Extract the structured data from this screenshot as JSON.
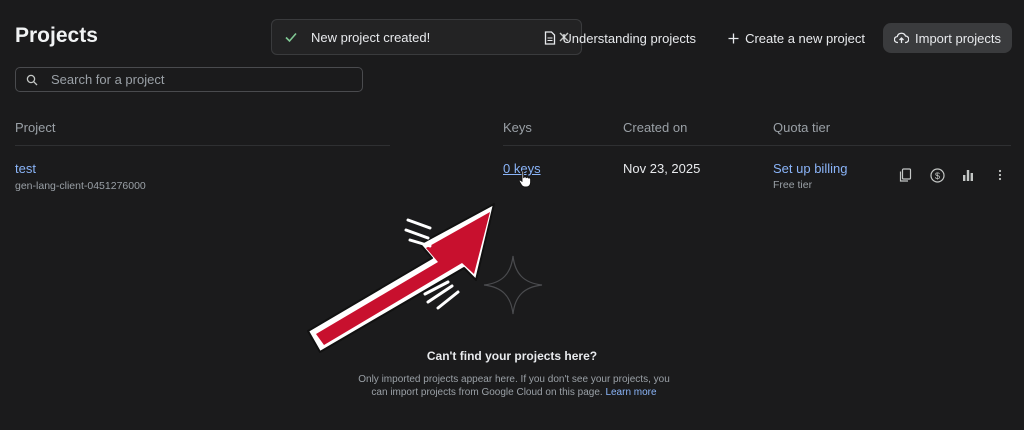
{
  "page": {
    "title": "Projects"
  },
  "toast": {
    "message": "New project created!"
  },
  "actions": {
    "understanding": "Understanding projects",
    "create": "Create a new project",
    "import": "Import projects"
  },
  "search": {
    "placeholder": "Search for a project"
  },
  "table": {
    "columns": [
      "Project",
      "Keys",
      "Created on",
      "Quota tier"
    ],
    "rows": [
      {
        "name": "test",
        "id": "gen-lang-client-0451276000",
        "keys": "0 keys",
        "created": "Nov 23, 2025",
        "billing": "Set up billing",
        "tier": "Free tier"
      }
    ]
  },
  "empty": {
    "title": "Can't find your projects here?",
    "desc_part1": "Only imported projects appear here. If you don't see your projects, you can import projects from Google Cloud on this page.",
    "link": "Learn more"
  },
  "colors": {
    "accent": "#8ab4f8",
    "success": "#81c995",
    "annotation": "#c8102e"
  },
  "icons": [
    "check-icon",
    "close-icon",
    "document-icon",
    "plus-icon",
    "cloud-upload-icon",
    "search-icon",
    "copy-icon",
    "dollar-icon",
    "bar-chart-icon",
    "more-vert-icon",
    "pointer-cursor-icon",
    "sparkle-icon"
  ]
}
